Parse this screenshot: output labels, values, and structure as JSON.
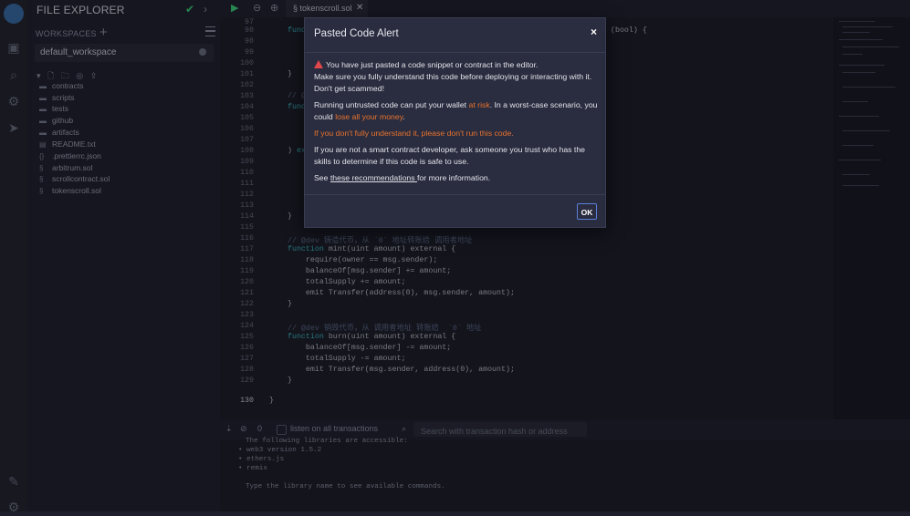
{
  "sidebar": {
    "title": "FILE EXPLORER",
    "workspaces_label": "WORKSPACES",
    "workspace_selected": "default_workspace",
    "tree": [
      {
        "name": "contracts",
        "type": "folder"
      },
      {
        "name": "scripts",
        "type": "folder"
      },
      {
        "name": "tests",
        "type": "folder"
      },
      {
        "name": "github",
        "type": "folder"
      },
      {
        "name": "artifacts",
        "type": "folder"
      },
      {
        "name": "README.txt",
        "type": "file"
      },
      {
        "name": ".prettierrc.json",
        "type": "file"
      },
      {
        "name": "arbitrum.sol",
        "type": "sol"
      },
      {
        "name": "scrollcontract.sol",
        "type": "sol"
      },
      {
        "name": "tokenscroll.sol",
        "type": "sol"
      }
    ]
  },
  "editor": {
    "tab_label": "tokenscroll.sol",
    "line_numbers": [
      "97",
      "98",
      "98",
      "99",
      "100",
      "101",
      "102",
      "103",
      "104",
      "105",
      "106",
      "107",
      "108",
      "109",
      "110",
      "111",
      "112",
      "113",
      "114",
      "115",
      "116",
      "117",
      "118",
      "119",
      "120",
      "121",
      "122",
      "123",
      "124",
      "125",
      "126",
      "127",
      "128",
      "129",
      "130"
    ],
    "lines": {
      "l115": "// @dev 铸造代币，从 `0` 地址转账给 调用者地址",
      "l116_kw": "function",
      "l116_rest": " mint(uint amount) external {",
      "l117": "    require(owner == msg.sender);",
      "l118": "    balanceOf[msg.sender] += amount;",
      "l119": "    totalSupply += amount;",
      "l120": "    emit Transfer(address(0), msg.sender, amount);",
      "l123": "// @dev 销毁代币，从 调用者地址 转账给  `0` 地址",
      "l124_kw": "function",
      "l124_rest": " burn(uint amount) external {",
      "l125": "    balanceOf[msg.sender] -= amount;",
      "l126": "    totalSupply -= amount;",
      "l127": "    emit Transfer(msg.sender, address(0), amount);",
      "top_right": "(bool) {"
    }
  },
  "terminal": {
    "tx_count": "0",
    "listen_label": "listen on all transactions",
    "search_placeholder": "Search with transaction hash or address",
    "lines": [
      "The following libraries are accessible:",
      "• web3 version 1.5.2",
      "• ethers.js",
      "• remix",
      "Type the library name to see available commands."
    ]
  },
  "modal": {
    "title": "Pasted Code Alert",
    "close": "×",
    "p1a": "You have just pasted a code snippet or contract in the editor.",
    "p1b": "Make sure you fully understand this code before deploying or interacting with it. Don't get scammed!",
    "p2a": "Running untrusted code can put your wallet ",
    "p2b": "at risk",
    "p2c": ". In a worst-case scenario, you could ",
    "p2d": "lose all your money",
    "p2e": ".",
    "p3": "If you don't fully understand it, please don't run this code.",
    "p4": "If you are not a smart contract developer, ask someone you trust who has the skills to determine if this code is safe to use.",
    "p5a": "See ",
    "p5b": "these recommendations ",
    "p5c": "for more information.",
    "ok": "OK"
  },
  "colors": {
    "accent": "#3fb5c2",
    "warning": "#e8742e",
    "danger": "#e0474c",
    "success": "#3ccf7a"
  }
}
